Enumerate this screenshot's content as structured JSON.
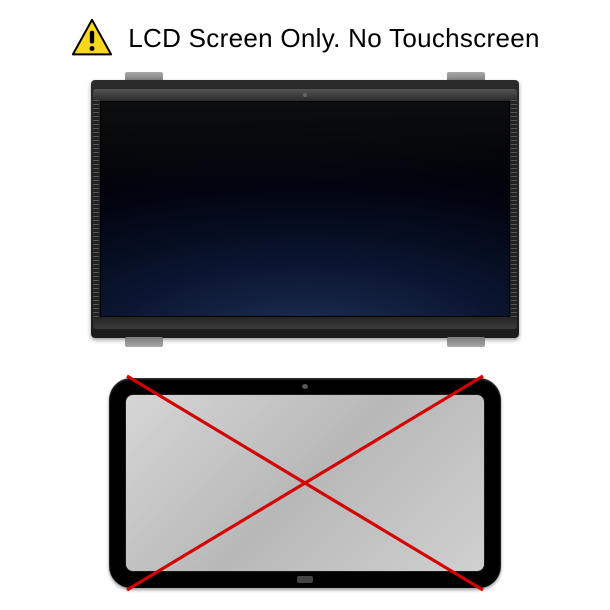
{
  "header": {
    "warning_icon": "warning-icon",
    "text": "LCD Screen Only. No Touchscreen"
  },
  "colors": {
    "warning_fill": "#f9d71c",
    "warning_stroke": "#000000",
    "cross_red": "#d40000"
  }
}
